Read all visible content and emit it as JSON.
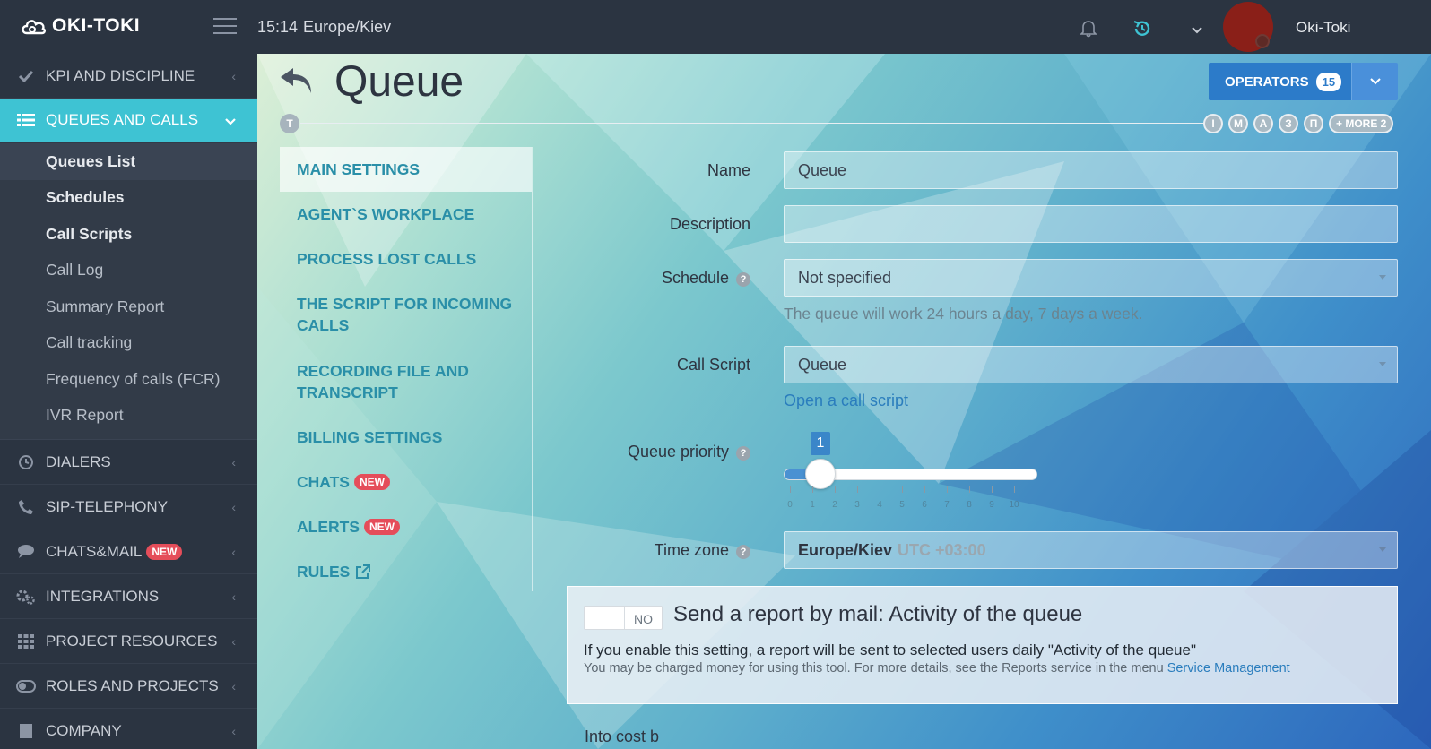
{
  "app": {
    "logo": "OKI-TOKI"
  },
  "header": {
    "time": "15:14",
    "timezone": "Europe/Kiev",
    "username": "Oki-Toki",
    "avatar_color": "#8a1f18"
  },
  "sidebar": {
    "sections": [
      {
        "label": "KPI AND DISCIPLINE",
        "icon": "check-icon"
      },
      {
        "label": "QUEUES AND CALLS",
        "icon": "list-icon",
        "active": true
      },
      {
        "label": "DIALERS",
        "icon": "clock-icon"
      },
      {
        "label": "SIP-TELEPHONY",
        "icon": "phone-icon"
      },
      {
        "label": "CHATS&MAIL",
        "icon": "chat-icon",
        "badge": "NEW"
      },
      {
        "label": "INTEGRATIONS",
        "icon": "gears-icon"
      },
      {
        "label": "PROJECT RESOURCES",
        "icon": "grid-icon"
      },
      {
        "label": "ROLES AND PROJECTS",
        "icon": "toggle-icon"
      },
      {
        "label": "COMPANY",
        "icon": "building-icon"
      }
    ],
    "subitems": [
      {
        "label": "Queues List"
      },
      {
        "label": "Schedules"
      },
      {
        "label": "Call Scripts"
      },
      {
        "label": "Call Log"
      },
      {
        "label": "Summary Report"
      },
      {
        "label": "Call tracking"
      },
      {
        "label": "Frequency of calls (FCR)"
      },
      {
        "label": "IVR Report"
      }
    ]
  },
  "page": {
    "title": "Queue",
    "t_badge": "T",
    "letter_badges": [
      "I",
      "M",
      "A",
      "З",
      "П"
    ],
    "more_badge": "+ MORE 2",
    "operators_label": "OPERATORS",
    "operators_count": "15"
  },
  "settings_nav": [
    {
      "label": "MAIN SETTINGS",
      "active": true
    },
    {
      "label": "AGENT`S WORKPLACE"
    },
    {
      "label": "PROCESS LOST CALLS"
    },
    {
      "label": "THE SCRIPT FOR INCOMING CALLS"
    },
    {
      "label": "RECORDING FILE AND TRANSCRIPT"
    },
    {
      "label": "BILLING SETTINGS"
    },
    {
      "label": "CHATS",
      "badge": "NEW"
    },
    {
      "label": "ALERTS",
      "badge": "NEW"
    },
    {
      "label": "RULES",
      "external": true
    }
  ],
  "form": {
    "name_label": "Name",
    "name_value": "Queue",
    "description_label": "Description",
    "description_value": "",
    "schedule_label": "Schedule",
    "schedule_value": "Not specified",
    "schedule_help": "The queue will work 24 hours a day, 7 days a week.",
    "call_script_label": "Call Script",
    "call_script_value": "Queue",
    "open_script_link": "Open a call script",
    "priority_label": "Queue priority",
    "priority_value": "1",
    "priority_min": 0,
    "priority_max": 10,
    "priority_ticks": [
      "0",
      "1",
      "2",
      "3",
      "4",
      "5",
      "6",
      "7",
      "8",
      "9",
      "10"
    ],
    "timezone_label": "Time zone",
    "timezone_value": "Europe/Kiev",
    "timezone_utc": "UTC +03:00",
    "help_glyph": "?"
  },
  "report": {
    "toggle_label": "NO",
    "title": "Send a report by mail: Activity of the queue",
    "description": "If you enable this setting, a report will be sent to selected users daily \"Activity of the queue\"",
    "note_prefix": "You may be charged money for using this tool. For more details, see the Reports service in the menu ",
    "note_link": "Service Management"
  },
  "footer_cut_text": "Into cost b"
}
